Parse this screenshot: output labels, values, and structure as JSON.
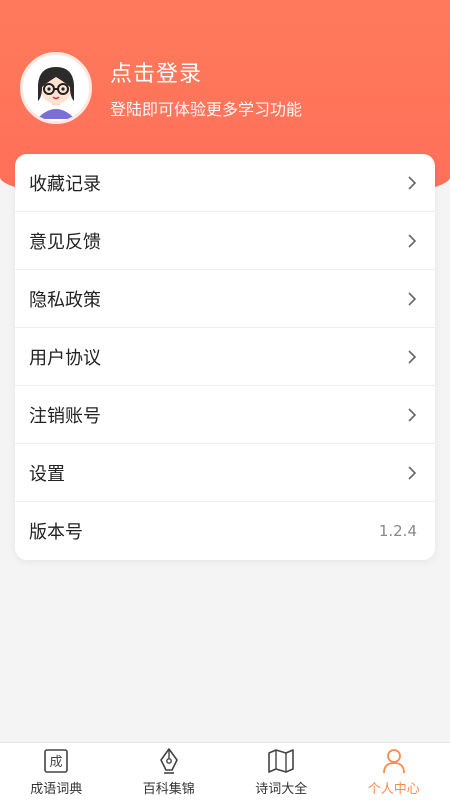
{
  "header": {
    "title": "点击登录",
    "subtitle": "登陆即可体验更多学习功能"
  },
  "menu": {
    "items": [
      {
        "label": "收藏记录"
      },
      {
        "label": "意见反馈"
      },
      {
        "label": "隐私政策"
      },
      {
        "label": "用户协议"
      },
      {
        "label": "注销账号"
      },
      {
        "label": "设置"
      }
    ],
    "version_label": "版本号",
    "version_value": "1.2.4"
  },
  "tabbar": {
    "tabs": [
      {
        "label": "成语词典",
        "icon": "idiom-book-icon",
        "glyph": "成"
      },
      {
        "label": "百科集锦",
        "icon": "pen-nib-icon"
      },
      {
        "label": "诗词大全",
        "icon": "book-map-icon"
      },
      {
        "label": "个人中心",
        "icon": "user-icon"
      }
    ],
    "active_index": 3
  },
  "colors": {
    "header": "#ff6f58",
    "active_tab": "#ff8a4c"
  }
}
